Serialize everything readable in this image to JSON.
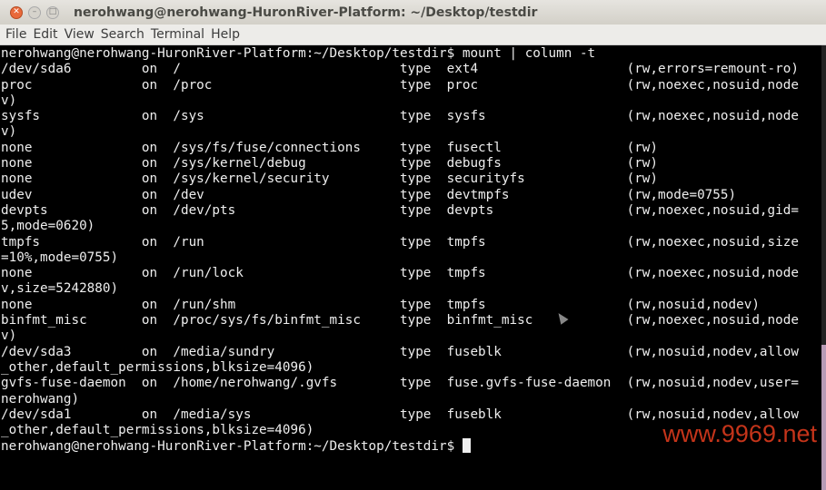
{
  "window": {
    "title": "nerohwang@nerohwang-HuronRiver-Platform: ~/Desktop/testdir"
  },
  "menu": [
    "File",
    "Edit",
    "View",
    "Search",
    "Terminal",
    "Help"
  ],
  "terminal": {
    "lines": [
      "nerohwang@nerohwang-HuronRiver-Platform:~/Desktop/testdir$ mount | column -t",
      "/dev/sda6         on  /                            type  ext4                   (rw,errors=remount-ro)",
      "proc              on  /proc                        type  proc                   (rw,noexec,nosuid,node",
      "v)",
      "sysfs             on  /sys                         type  sysfs                  (rw,noexec,nosuid,node",
      "v)",
      "none              on  /sys/fs/fuse/connections     type  fusectl                (rw)",
      "none              on  /sys/kernel/debug            type  debugfs                (rw)",
      "none              on  /sys/kernel/security         type  securityfs             (rw)",
      "udev              on  /dev                         type  devtmpfs               (rw,mode=0755)",
      "devpts            on  /dev/pts                     type  devpts                 (rw,noexec,nosuid,gid=",
      "5,mode=0620)",
      "tmpfs             on  /run                         type  tmpfs                  (rw,noexec,nosuid,size",
      "=10%,mode=0755)",
      "none              on  /run/lock                    type  tmpfs                  (rw,noexec,nosuid,node",
      "v,size=5242880)",
      "none              on  /run/shm                     type  tmpfs                  (rw,nosuid,nodev)",
      "binfmt_misc       on  /proc/sys/fs/binfmt_misc     type  binfmt_misc            (rw,noexec,nosuid,node",
      "v)",
      "/dev/sda3         on  /media/sundry                type  fuseblk                (rw,nosuid,nodev,allow",
      "_other,default_permissions,blksize=4096)",
      "gvfs-fuse-daemon  on  /home/nerohwang/.gvfs        type  fuse.gvfs-fuse-daemon  (rw,nosuid,nodev,user=",
      "nerohwang)",
      "/dev/sda1         on  /media/sys                   type  fuseblk                (rw,nosuid,nodev,allow",
      "_other,default_permissions,blksize=4096)"
    ],
    "prompt": "nerohwang@nerohwang-HuronRiver-Platform:~/Desktop/testdir$ "
  },
  "watermark": "www.9969.net"
}
